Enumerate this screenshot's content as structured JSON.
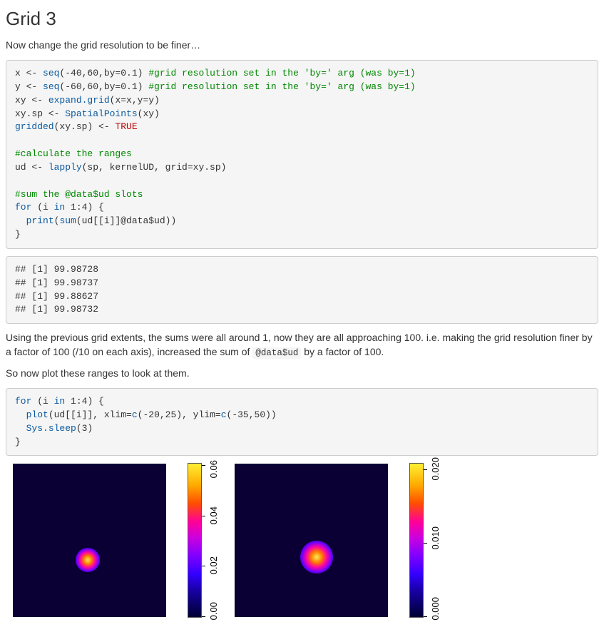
{
  "heading": "Grid 3",
  "intro": "Now change the grid resolution to be finer…",
  "code1": {
    "l1a": "x <- ",
    "l1b": "seq",
    "l1c": "(-40,60,by=0.1) ",
    "l1d": "#grid resolution set in the 'by=' arg (was by=1)",
    "l2a": "y <- ",
    "l2b": "seq",
    "l2c": "(-60,60,by=0.1) ",
    "l2d": "#grid resolution set in the 'by=' arg (was by=1)",
    "l3a": "xy <- ",
    "l3b": "expand.grid",
    "l3c": "(x=x,y=y)",
    "l4a": "xy.sp <- ",
    "l4b": "SpatialPoints",
    "l4c": "(xy)",
    "l5a": "gridded",
    "l5b": "(xy.sp) <- ",
    "l5c": "TRUE",
    "l7": "#calculate the ranges",
    "l8a": "ud <- ",
    "l8b": "lapply",
    "l8c": "(sp, kernelUD, grid=xy.sp)",
    "l10": "#sum the @data$ud slots",
    "l11a": "for",
    "l11b": " (i ",
    "l11c": "in",
    "l11d": " 1:4) {",
    "l12a": "  ",
    "l12b": "print",
    "l12c": "(",
    "l12d": "sum",
    "l12e": "(ud[[i]]@data$ud))",
    "l13": "}"
  },
  "output1": "## [1] 99.98728\n## [1] 99.98737\n## [1] 99.88627\n## [1] 99.98732",
  "para1a": "Using the previous grid extents, the sums were all around 1, now they are all approaching 100. i.e. making the grid resolution finer by a factor of 100 (/10 on each axis), increased the sum of ",
  "para1code": "@data$ud",
  "para1b": " by a factor of 100.",
  "para2": "So now plot these ranges to look at them.",
  "code2": {
    "l1a": "for",
    "l1b": " (i ",
    "l1c": "in",
    "l1d": " 1:4) {",
    "l2a": "  ",
    "l2b": "plot",
    "l2c": "(ud[[i]], xlim=",
    "l2d": "c",
    "l2e": "(-20,25), ylim=",
    "l2f": "c",
    "l2g": "(-35,50))",
    "l3a": "  ",
    "l3b": "Sys.sleep",
    "l3c": "(3)",
    "l4": "}"
  },
  "chart_data": [
    {
      "type": "heatmap",
      "title": "",
      "xlabel": "",
      "ylabel": "",
      "xlim": [
        -20,
        25
      ],
      "ylim": [
        -35,
        50
      ],
      "peak_xy": [
        0,
        5
      ],
      "colorbar_ticks": [
        "0.00",
        "0.02",
        "0.04",
        "0.06"
      ],
      "colorbar_range": [
        0.0,
        0.06
      ]
    },
    {
      "type": "heatmap",
      "title": "",
      "xlabel": "",
      "ylabel": "",
      "xlim": [
        -20,
        25
      ],
      "ylim": [
        -35,
        50
      ],
      "peak_xy": [
        2,
        5
      ],
      "colorbar_ticks": [
        "0.000",
        "0.010",
        "0.020"
      ],
      "colorbar_range": [
        0.0,
        0.02
      ]
    }
  ]
}
